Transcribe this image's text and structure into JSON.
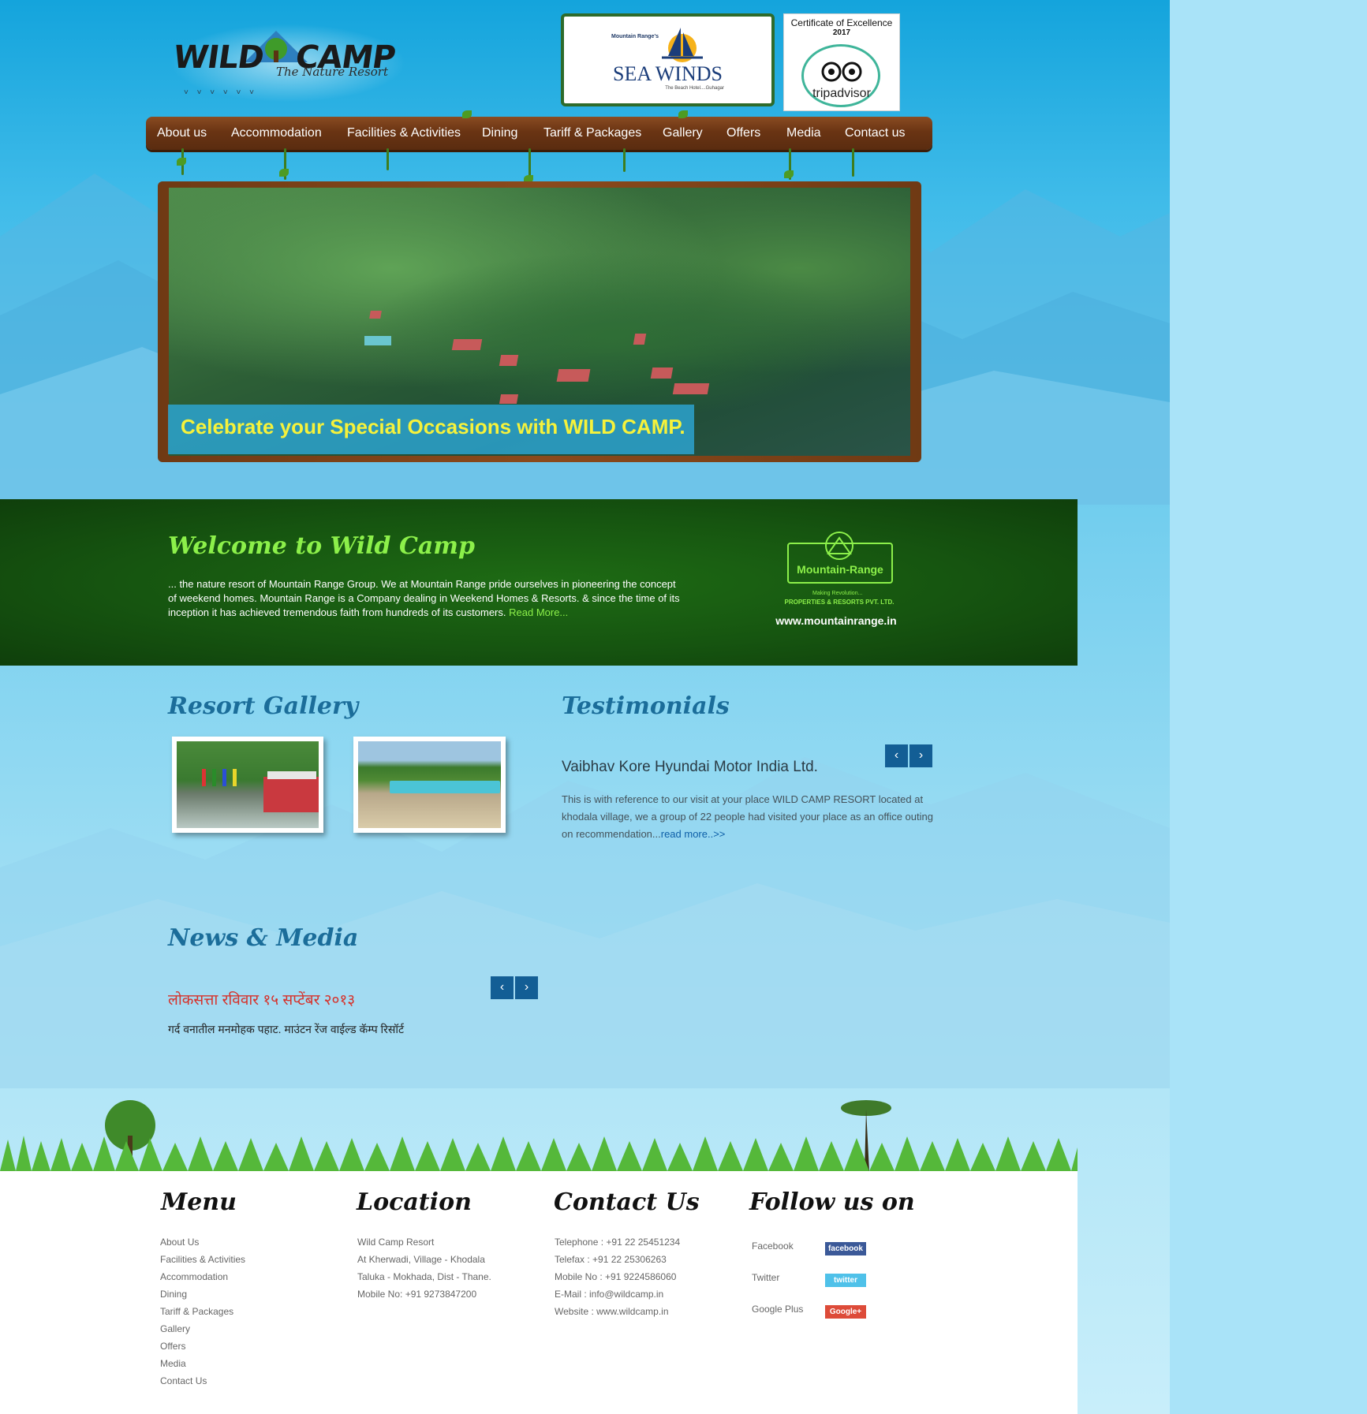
{
  "brand": {
    "logo_word_left": "WILD",
    "logo_word_right": "CAMP",
    "logo_tagline": "The Nature Resort"
  },
  "badges": {
    "seawinds": {
      "small": "Mountain Range's",
      "title": "SEA WINDS",
      "tagline": "The Beach Hotel....Guhagar"
    },
    "tripadvisor": {
      "cert": "Certificate of Excellence",
      "year": "2017",
      "word": "tripadvisor"
    }
  },
  "nav": {
    "items": [
      {
        "label": "About us"
      },
      {
        "label": "Accommodation"
      },
      {
        "label": "Facilities & Activities"
      },
      {
        "label": "Dining"
      },
      {
        "label": "Tariff & Packages"
      },
      {
        "label": "Gallery"
      },
      {
        "label": "Offers"
      },
      {
        "label": "Media"
      },
      {
        "label": "Contact us"
      }
    ]
  },
  "hero": {
    "caption": "Celebrate your Special Occasions with WILD CAMP."
  },
  "welcome": {
    "title": "Welcome to Wild Camp",
    "text": "... the nature resort of Mountain Range Group. We at Mountain Range pride ourselves in pioneering the concept of weekend homes. Mountain Range is a Company dealing in Weekend Homes & Resorts. & since the time of its inception it has achieved tremendous faith from hundreds of its customers.",
    "read_more": "Read More...",
    "partner_logo": "Mountain-Range",
    "partner_small": "Making Revolution...",
    "partner_sub": "PROPERTIES & RESORTS PVT. LTD.",
    "partner_url": "www.mountainrange.in"
  },
  "gallery": {
    "title": "Resort Gallery"
  },
  "testimonials": {
    "title": "Testimonials",
    "prev": "‹",
    "next": "›",
    "name": "Vaibhav Kore Hyundai Motor India Ltd.",
    "text": "This is with reference to our visit at your place WILD CAMP RESORT located at khodala village, we a group of 22 people had visited your place as an office outing on recommendation...",
    "read_more": "read more..>>"
  },
  "news": {
    "title": "News & Media",
    "prev": "‹",
    "next": "›",
    "headline": "लोकसत्ता रविवार १५ सप्टेंबर २०१३",
    "text": "गर्द वनातील मनमोहक पहाट. माउंटन रेंज वाईल्ड कॅम्प रिसॉर्ट"
  },
  "footer": {
    "menu": {
      "title": "Menu",
      "items": [
        "About Us",
        "Facilities & Activities",
        "Accommodation",
        "Dining",
        "Tariff & Packages",
        "Gallery",
        "Offers",
        "Media",
        "Contact Us"
      ]
    },
    "location": {
      "title": "Location",
      "lines": [
        "Wild Camp Resort",
        "At Kherwadi, Village - Khodala",
        "Taluka - Mokhada, Dist - Thane.",
        "Mobile No: +91 9273847200"
      ]
    },
    "contact": {
      "title": "Contact Us",
      "lines": [
        "Telephone : +91 22 25451234",
        "Telefax : +91 22 25306263",
        "Mobile No : +91 9224586060",
        "E-Mail : info@wildcamp.in",
        "Website : www.wildcamp.in"
      ]
    },
    "follow": {
      "title": "Follow us on",
      "facebook": {
        "label": "Facebook",
        "badge": "facebook",
        "color": "#3b5998"
      },
      "twitter": {
        "label": "Twitter",
        "badge": "twitter",
        "color": "#4fc1e9"
      },
      "google": {
        "label": "Google Plus",
        "badge": "Google+",
        "color": "#dd4b39"
      }
    }
  }
}
